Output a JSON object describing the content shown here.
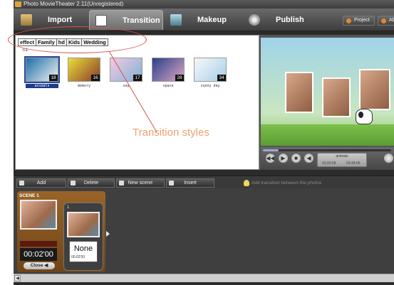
{
  "window": {
    "title": "Photo MovieTheater 2.11(Unregistered)"
  },
  "main_tabs": [
    {
      "label": "Import",
      "icon": "import-icon"
    },
    {
      "label": "Transition",
      "icon": "transition-icon",
      "active": true
    },
    {
      "label": "Makeup",
      "icon": "makeup-icon"
    },
    {
      "label": "Publish",
      "icon": "publish-icon"
    }
  ],
  "top_buttons": {
    "project": "Project",
    "about": "Ab"
  },
  "categories": [
    {
      "label": "effect",
      "active": true
    },
    {
      "label": "Family"
    },
    {
      "label": "hd"
    },
    {
      "label": "Kids"
    },
    {
      "label": "Wedding"
    }
  ],
  "subheading": "01",
  "thumbnails": [
    {
      "name": "animals",
      "count": "18",
      "selected": true,
      "colors": [
        "#1b6fa8",
        "#f2f2f2"
      ]
    },
    {
      "name": "memory",
      "count": "16",
      "colors": [
        "#e9df3a",
        "#8a3a2a"
      ]
    },
    {
      "name": "sea",
      "count": "17",
      "colors": [
        "#f6c9df",
        "#7fb3d8"
      ]
    },
    {
      "name": "space",
      "count": "28",
      "colors": [
        "#2a3f8a",
        "#d9a6c2"
      ]
    },
    {
      "name": "sunny day",
      "count": "34",
      "colors": [
        "#f7f7f7",
        "#a6d0ea"
      ]
    }
  ],
  "annotation": {
    "text": "Transition styles",
    "color": "#f0a070"
  },
  "preview": {
    "clip_name": "animals",
    "time_current": "00:00:58",
    "time_total": "00:48:06",
    "progress": 0.12
  },
  "scene_toolbar": {
    "add": "Add",
    "delete": "Delete",
    "new_scene": "New scene",
    "insert": "Insert",
    "hint": "Add transition between the photos"
  },
  "scene": {
    "label": "SCENE 1",
    "duration_bar": "",
    "time": "00:02'00",
    "close": "Close"
  },
  "transition_slot": {
    "index": "1",
    "name": "None",
    "time": "00:02'00"
  }
}
